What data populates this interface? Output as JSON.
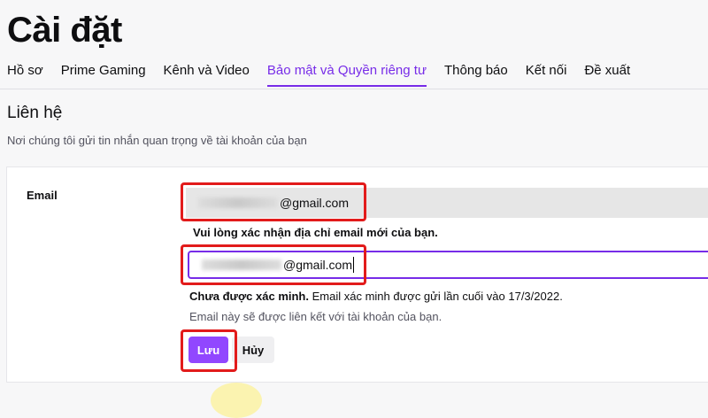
{
  "page_title": "Cài đặt",
  "tabs": [
    {
      "label": "Hồ sơ",
      "active": false
    },
    {
      "label": "Prime Gaming",
      "active": false
    },
    {
      "label": "Kênh và Video",
      "active": false
    },
    {
      "label": "Bảo mật và Quyền riêng tư",
      "active": true
    },
    {
      "label": "Thông báo",
      "active": false
    },
    {
      "label": "Kết nối",
      "active": false
    },
    {
      "label": "Đề xuất",
      "active": false
    }
  ],
  "section": {
    "title": "Liên hệ",
    "subtitle": "Nơi chúng tôi gửi tin nhắn quan trọng về tài khoản của bạn"
  },
  "email": {
    "label": "Email",
    "current_value_visible": "@gmail.com",
    "confirm_prompt": "Vui lòng xác nhận địa chỉ email mới của bạn.",
    "new_value_visible": "@gmail.com",
    "status_bold": "Chưa được xác minh.",
    "status_text": " Email xác minh được gửi lần cuối vào 17/3/2022.",
    "note": "Email này sẽ được liên kết với tài khoản của bạn.",
    "save_label": "Lưu",
    "cancel_label": "Hủy"
  },
  "colors": {
    "accent": "#9147ff",
    "active_tab": "#772ce8",
    "highlight": "#e21b1b"
  }
}
